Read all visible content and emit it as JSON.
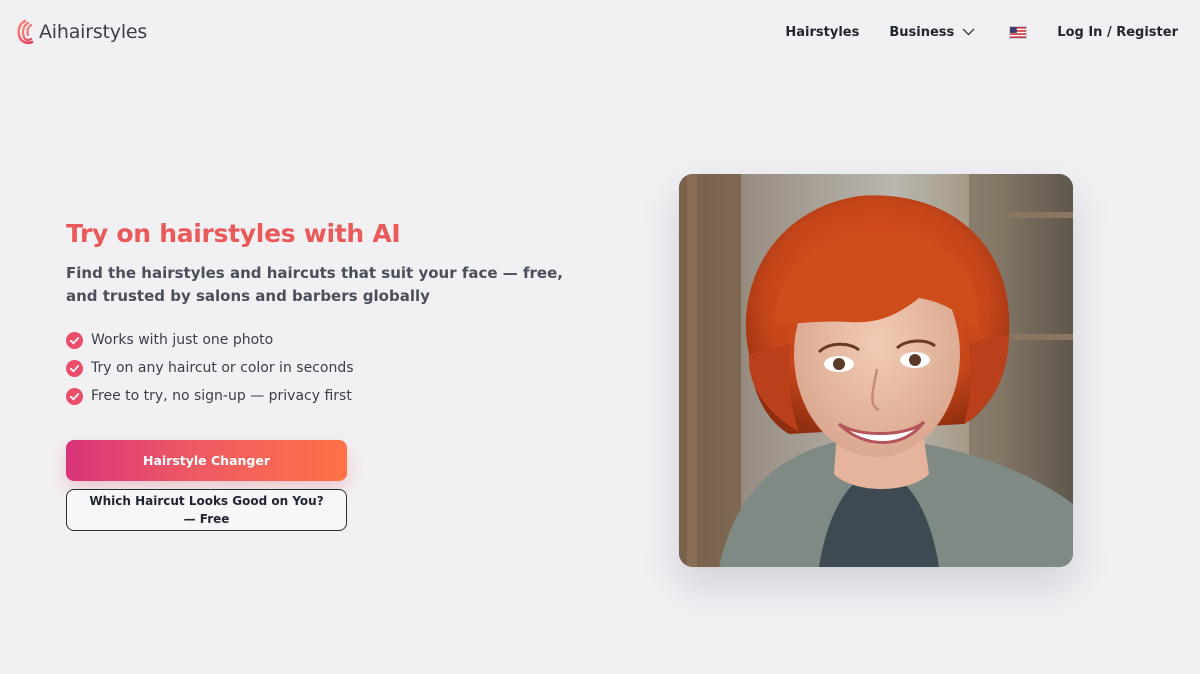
{
  "header": {
    "logo_text": "Aihairstyles",
    "nav": {
      "hairstyles": "Hairstyles",
      "business": "Business",
      "login": "Log In / Register"
    },
    "language_flag": "us-flag-icon"
  },
  "hero": {
    "title": "Try on hairstyles with AI",
    "subtitle": "Find the hairstyles and haircuts that suit your face — free, and trusted by salons and barbers globally",
    "features": [
      "Works with just one photo",
      "Try on any haircut or color in seconds",
      "Free to try, no sign-up — privacy first"
    ],
    "primary_button": "Hairstyle Changer",
    "secondary_button": "Which Haircut Looks Good on You? — Free",
    "image_alt": "Smiling woman with a red-orange bob haircut and bangs"
  },
  "colors": {
    "accent": "#ea5a5a",
    "gradient_start": "#d9337a",
    "gradient_end": "#ff7146",
    "background": "#f1f1f4"
  },
  "icons": {
    "check": "check-circle-icon",
    "chevron": "chevron-down-icon",
    "logo": "logo-mark-icon"
  }
}
